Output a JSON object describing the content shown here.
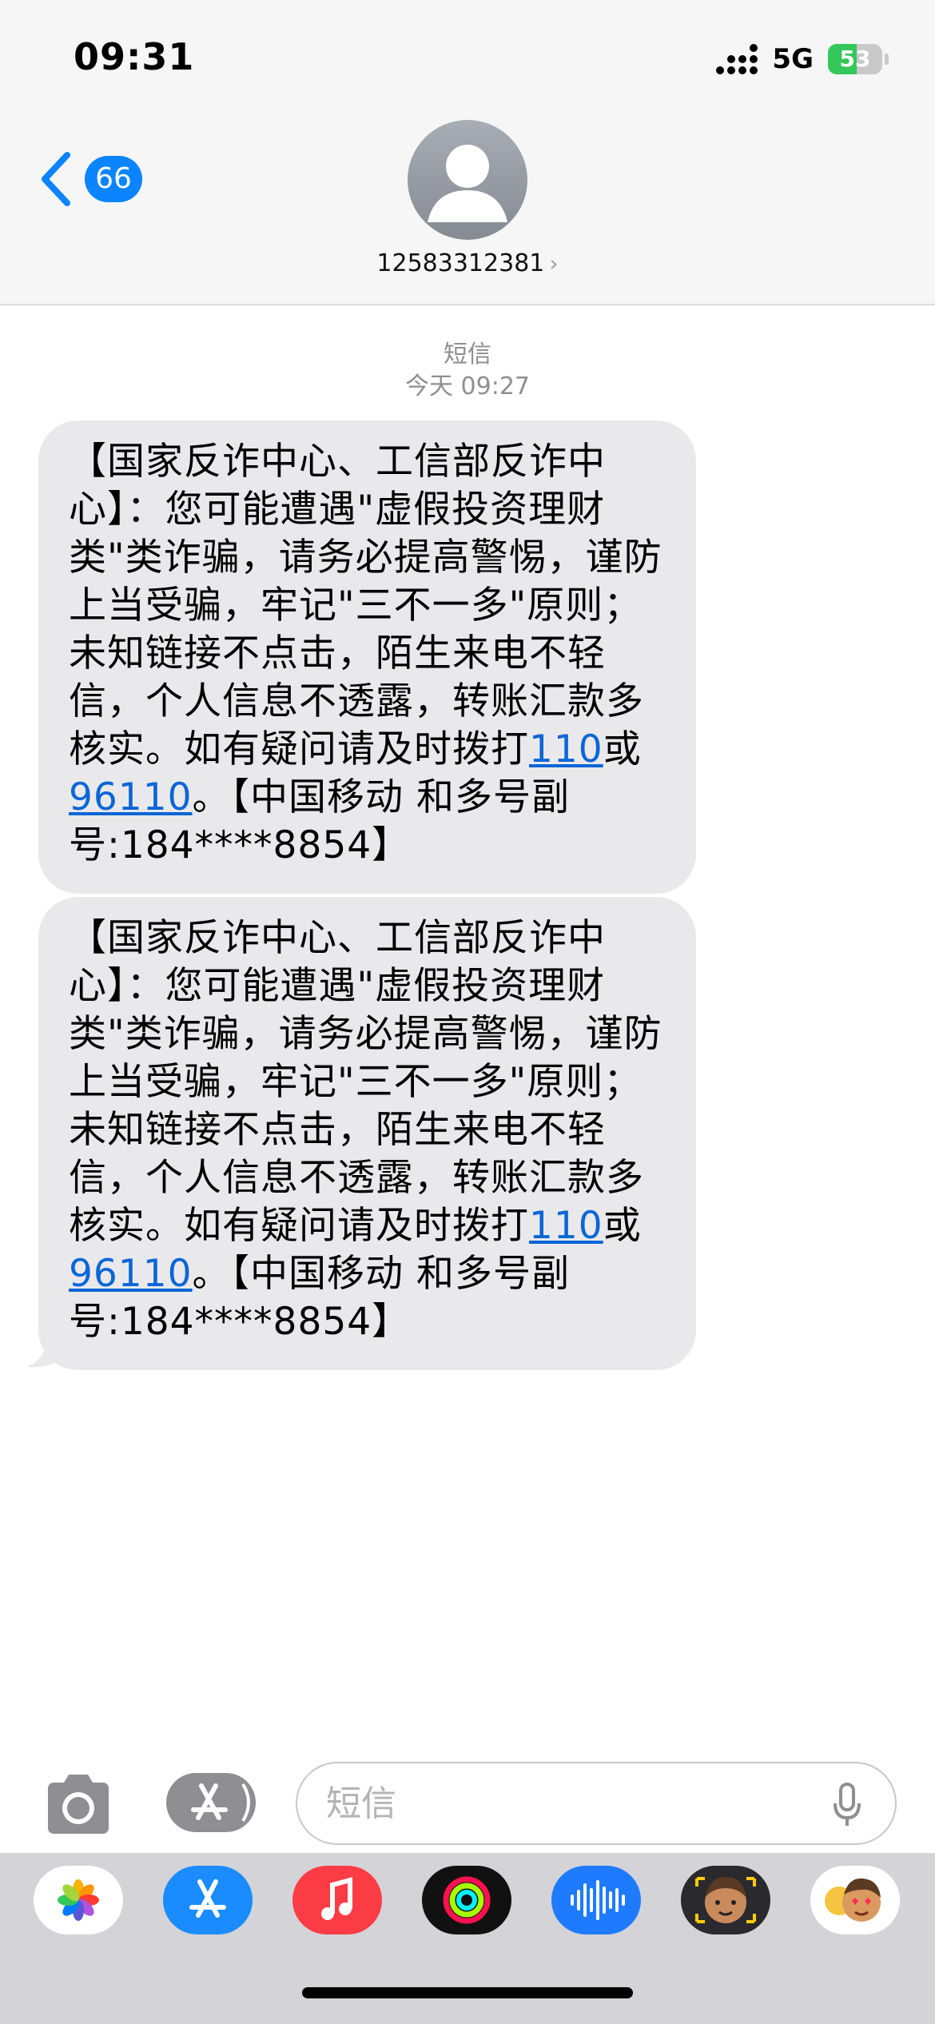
{
  "status_bar": {
    "time": "09:31",
    "network": "5G",
    "battery_level": 53,
    "battery_text": "53"
  },
  "header": {
    "back_badge_count": "66",
    "contact_number": "12583312381",
    "contact_chevron": "›"
  },
  "conversation": {
    "service_label": "短信",
    "timestamp": "今天 09:27",
    "messages": [
      {
        "text_part1": "【国家反诈中心、工信部反诈中心】：您可能遭遇\"虚假投资理财类\"类诈骗，请务必提高警惕，谨防上当受骗，牢记\"三不一多\"原则；未知链接不点击，陌生来电不轻信，个人信息不透露，转账汇款多核实。如有疑问请及时拨打",
        "link1": "110",
        "text_part2": "或",
        "link2": "96110",
        "text_part3": "。【中国移动 和多号副号:184****8854】"
      },
      {
        "text_part1": "【国家反诈中心、工信部反诈中心】：您可能遭遇\"虚假投资理财类\"类诈骗，请务必提高警惕，谨防上当受骗，牢记\"三不一多\"原则；未知链接不点击，陌生来电不轻信，个人信息不透露，转账汇款多核实。如有疑问请及时拨打",
        "link1": "110",
        "text_part2": "或",
        "link2": "96110",
        "text_part3": "。【中国移动 和多号副号:184****8854】"
      }
    ]
  },
  "input_bar": {
    "placeholder": "短信"
  },
  "app_drawer": {
    "apps": [
      {
        "icon": "photos-icon"
      },
      {
        "icon": "app-store-icon"
      },
      {
        "icon": "music-icon"
      },
      {
        "icon": "fitness-icon"
      },
      {
        "icon": "voice-memos-icon"
      },
      {
        "icon": "memoji-sticker-icon"
      },
      {
        "icon": "memoji-emoji-icon"
      }
    ]
  },
  "colors": {
    "accent": "#0a84ff",
    "bubble": "#e9e9eb",
    "link": "#0a66d6",
    "header_bg": "#f6f6f6",
    "battery_fill": "#34c759"
  }
}
